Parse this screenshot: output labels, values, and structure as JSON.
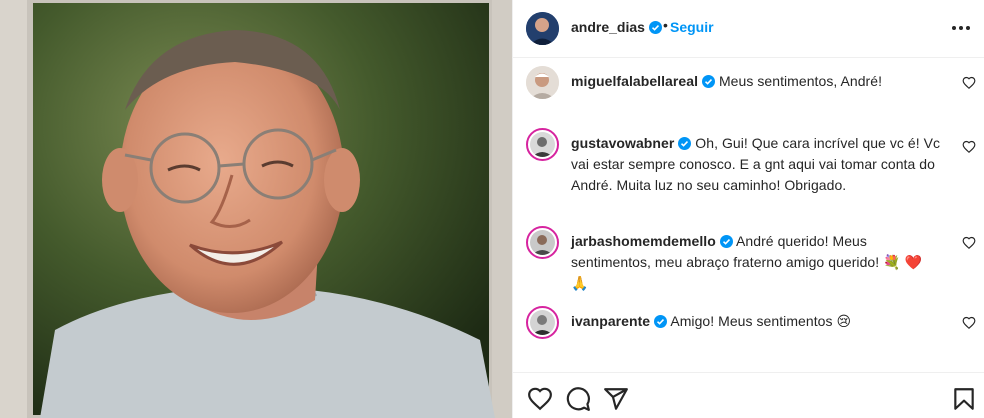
{
  "post": {
    "author": "andre_dias",
    "follow_label": "Seguir",
    "photo_icon": "portrait-photo"
  },
  "comments": [
    {
      "user": "miguelfalabellareal",
      "text": "Meus sentimentos, André!"
    },
    {
      "user": "gustavowabner",
      "text": "Oh, Gui! Que cara incrível que vc é! Vc vai estar sempre conosco. E a gnt aqui vai tomar conta do André. Muita luz no seu caminho! Obrigado."
    },
    {
      "user": "jarbashomemdemello",
      "text": "André querido! Meus sentimentos, meu abraço fraterno amigo querido! 💐 ❤️ 🙏"
    },
    {
      "user": "ivanparente",
      "text": "Amigo! Meus sentimentos 😢"
    }
  ],
  "icons": {
    "verified": "verified-badge-icon",
    "more": "more-options-icon",
    "like": "heart-icon",
    "comment": "comment-icon",
    "share": "share-icon",
    "save": "bookmark-icon"
  },
  "colors": {
    "accent": "#0095f6",
    "verified": "#0095f6",
    "ring": "#d6249f",
    "text": "#262626"
  }
}
